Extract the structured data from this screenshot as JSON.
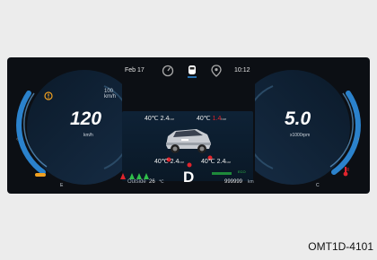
{
  "topbar": {
    "date": "Feb 17",
    "time": "10:12"
  },
  "speedometer": {
    "speed": "120",
    "unit": "km/h",
    "limit": "100 km/h"
  },
  "tachometer": {
    "rpm": "5.0",
    "unit": "x1000rpm"
  },
  "tires": {
    "front_left": {
      "temp": "40℃",
      "pressure": "2.4",
      "unit": "bar"
    },
    "front_right": {
      "temp": "40℃",
      "pressure": "1.4",
      "unit": "bar"
    },
    "rear_left": {
      "temp": "40℃",
      "pressure": "2.4",
      "unit": "bar"
    },
    "rear_right": {
      "temp": "40℃",
      "pressure": "2.4",
      "unit": "bar"
    }
  },
  "bottom": {
    "outside_label": "Outside",
    "outside_temp": "26",
    "outside_unit": "℃",
    "gear": "D",
    "odometer": "999999",
    "odometer_unit": "km",
    "trip_badge": "ECO"
  },
  "gauges": {
    "fuel_low_label": "E",
    "temp_low_label": "C"
  },
  "colors": {
    "accent_blue": "#2f8fe0",
    "warning_red": "#e0242c",
    "indicator_green": "#2fbf4a",
    "amber": "#f0a020"
  },
  "caption": "OMT1D-4101"
}
